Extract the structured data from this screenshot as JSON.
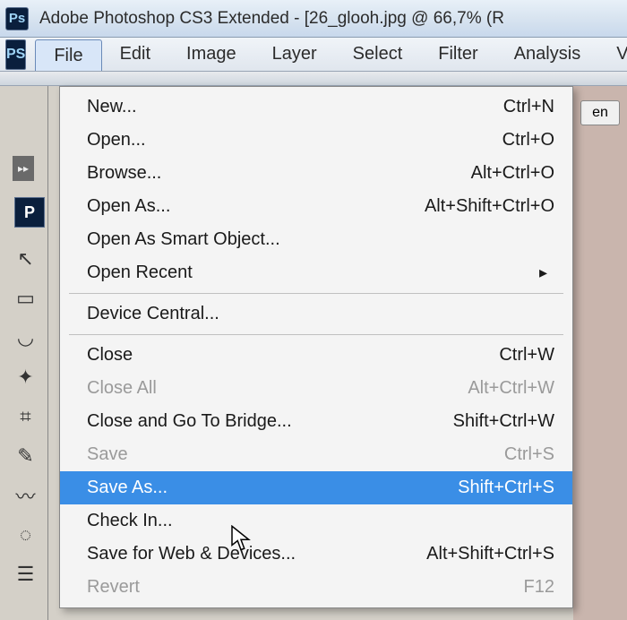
{
  "titlebar": {
    "text": "Adobe Photoshop CS3 Extended - [26_glooh.jpg @ 66,7% (R"
  },
  "menubar": {
    "items": [
      "File",
      "Edit",
      "Image",
      "Layer",
      "Select",
      "Filter",
      "Analysis",
      "Vie"
    ]
  },
  "side_button": {
    "label": "en"
  },
  "dropdown": {
    "groups": [
      [
        {
          "label": "New...",
          "shortcut": "Ctrl+N",
          "enabled": true,
          "submenu": false,
          "sel": false
        },
        {
          "label": "Open...",
          "shortcut": "Ctrl+O",
          "enabled": true,
          "submenu": false,
          "sel": false
        },
        {
          "label": "Browse...",
          "shortcut": "Alt+Ctrl+O",
          "enabled": true,
          "submenu": false,
          "sel": false
        },
        {
          "label": "Open As...",
          "shortcut": "Alt+Shift+Ctrl+O",
          "enabled": true,
          "submenu": false,
          "sel": false
        },
        {
          "label": "Open As Smart Object...",
          "shortcut": "",
          "enabled": true,
          "submenu": false,
          "sel": false
        },
        {
          "label": "Open Recent",
          "shortcut": "",
          "enabled": true,
          "submenu": true,
          "sel": false
        }
      ],
      [
        {
          "label": "Device Central...",
          "shortcut": "",
          "enabled": true,
          "submenu": false,
          "sel": false
        }
      ],
      [
        {
          "label": "Close",
          "shortcut": "Ctrl+W",
          "enabled": true,
          "submenu": false,
          "sel": false
        },
        {
          "label": "Close All",
          "shortcut": "Alt+Ctrl+W",
          "enabled": false,
          "submenu": false,
          "sel": false
        },
        {
          "label": "Close and Go To Bridge...",
          "shortcut": "Shift+Ctrl+W",
          "enabled": true,
          "submenu": false,
          "sel": false
        },
        {
          "label": "Save",
          "shortcut": "Ctrl+S",
          "enabled": false,
          "submenu": false,
          "sel": false
        },
        {
          "label": "Save As...",
          "shortcut": "Shift+Ctrl+S",
          "enabled": true,
          "submenu": false,
          "sel": true
        },
        {
          "label": "Check In...",
          "shortcut": "",
          "enabled": true,
          "submenu": false,
          "sel": false
        },
        {
          "label": "Save for Web & Devices...",
          "shortcut": "Alt+Shift+Ctrl+S",
          "enabled": true,
          "submenu": false,
          "sel": false
        },
        {
          "label": "Revert",
          "shortcut": "F12",
          "enabled": false,
          "submenu": false,
          "sel": false
        }
      ]
    ]
  }
}
